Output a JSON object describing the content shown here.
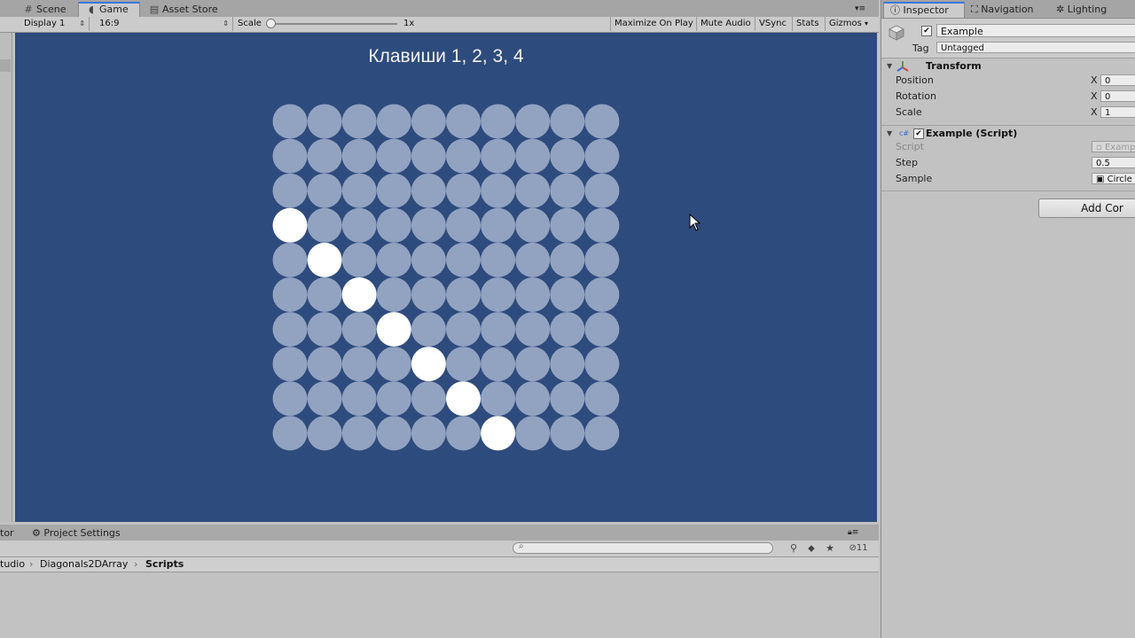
{
  "game_tabs": [
    {
      "label": "Scene",
      "icon": "grid-icon"
    },
    {
      "label": "Game",
      "icon": "pacman-icon"
    },
    {
      "label": "Asset Store",
      "icon": "store-icon"
    }
  ],
  "game_toolbar": {
    "display": "Display 1",
    "aspect": "16:9",
    "scale_label": "Scale",
    "scale_value": "1x",
    "buttons": [
      "Maximize On Play",
      "Mute Audio",
      "VSync",
      "Stats",
      "Gizmos"
    ]
  },
  "game": {
    "title": "Клавиши 1, 2, 3, 4",
    "grid": {
      "rows": 10,
      "cols": 10,
      "highlighted": [
        [
          3,
          0
        ],
        [
          4,
          1
        ],
        [
          5,
          2
        ],
        [
          6,
          3
        ],
        [
          7,
          4
        ],
        [
          8,
          5
        ],
        [
          9,
          6
        ]
      ]
    },
    "colors": {
      "background": "#2e4b7d",
      "circle": "#92a3c1",
      "highlight": "#ffffff"
    }
  },
  "bottom": {
    "tab_partial": "tor",
    "tab_settings": "Project Settings",
    "search_placeholder": "",
    "hidden_count": "11",
    "breadcrumb": [
      "tudio",
      "Diagonals2DArray",
      "Scripts"
    ]
  },
  "inspector": {
    "tabs": [
      {
        "label": "Inspector",
        "icon": "info-icon"
      },
      {
        "label": "Navigation",
        "icon": "navigation-icon"
      },
      {
        "label": "Lighting",
        "icon": "lighting-icon"
      }
    ],
    "object_name": "Example",
    "tag_label": "Tag",
    "tag_value": "Untagged",
    "transform": {
      "title": "Transform",
      "position_label": "Position",
      "rotation_label": "Rotation",
      "scale_label": "Scale",
      "axis_label": "X",
      "position_x": "0",
      "rotation_x": "0",
      "scale_x": "1"
    },
    "script_component": {
      "title": "Example (Script)",
      "script_label": "Script",
      "script_value": "Examp",
      "step_label": "Step",
      "step_value": "0.5",
      "sample_label": "Sample",
      "sample_value": "Circle"
    },
    "add_component": "Add Cor"
  }
}
